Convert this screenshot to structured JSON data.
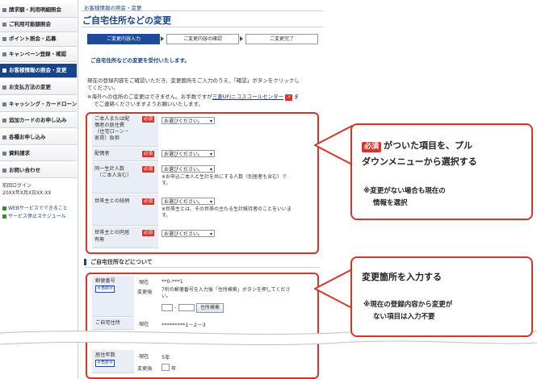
{
  "sidebar": {
    "items": [
      {
        "label": "請求額・利用明細照会",
        "active": false
      },
      {
        "label": "ご利用可能額照会",
        "active": false
      },
      {
        "label": "ポイント照会・応募",
        "active": false
      },
      {
        "label": "キャンペーン登録・確認",
        "active": false
      },
      {
        "label": "お客様情報の照会・変更",
        "active": true
      },
      {
        "label": "お支払方法の変更",
        "active": false
      },
      {
        "label": "キャッシング・カードローン",
        "active": false
      },
      {
        "label": "追加カードのお申し込み",
        "active": false
      },
      {
        "label": "各種お申し込み",
        "active": false
      },
      {
        "label": "資料請求",
        "active": false
      },
      {
        "label": "お問い合わせ",
        "active": false
      }
    ],
    "last_login_label": "前回ログイン",
    "last_login_value": "20XX年X月X日XX:XX",
    "links": [
      "WEBサービスでできること",
      "サービス停止スケジュール"
    ]
  },
  "header": {
    "breadcrumb": "お客様情報の照会・変更",
    "title": "ご自宅住所などの変更"
  },
  "steps": [
    "ご変更内容入力",
    "ご変更内容の確認",
    "ご変更完了"
  ],
  "intro": {
    "accept": "ご自宅住所などの変更を受付いたします。",
    "p1_l1": "現在の登録内容をご確認いただき、変更箇所をご入力のうえ、「確認」ボタンをクリックし",
    "p1_l2": "てください。",
    "p2_l1a": "※海外への住所のご変更はできません。お手数ですが",
    "p2_link": "三菱UFJニコスコールセンター",
    "p2_l1b": "ま",
    "p2_l2": "でご連絡くださいますようお願いいたします。"
  },
  "required_label": "必須",
  "select_placeholder": "お選びください。",
  "household": {
    "rows": [
      {
        "label_l1": "ご本人または配",
        "label_l2": "偶者の居住費",
        "label_l3": "（住宅ローン・",
        "label_l4": "家賃）負担",
        "note1": "",
        "note2": ""
      },
      {
        "label_l1": "配偶者",
        "label_l2": "",
        "label_l3": "",
        "label_l4": "",
        "note1": "",
        "note2": ""
      },
      {
        "label_l1": "同一生計人数",
        "label_l2": "（ご本人含む）",
        "label_l3": "",
        "label_l4": "",
        "note1": "※お申込ご本人と生計を共にする人数（別居者も含む）で",
        "note2": "す。"
      },
      {
        "label_l1": "世帯主との続柄",
        "label_l2": "",
        "label_l3": "",
        "label_l4": "",
        "note1": "※世帯主とは、その世帯の主たる生計維持者のことをいいま",
        "note2": "す。"
      },
      {
        "label_l1": "世帯主との同居",
        "label_l2": "有無",
        "label_l3": "",
        "label_l4": "",
        "note1": "",
        "note2": ""
      }
    ]
  },
  "address_section": {
    "heading": "ご自宅住所などについて",
    "postal_label": "郵便番号",
    "postal_badge": "半角数字",
    "current_label": "現在",
    "after_label": "変更後",
    "postal_current": "**0-***1",
    "postal_instruction_l1": "7桁の郵便番号を入力後「住所検索」ボタンを押してくださ",
    "postal_instruction_l2": "い。",
    "dash": "-",
    "search_button": "住所検索",
    "address_label": "ご自宅住所",
    "address_current": "*********1－2－3",
    "years_label": "居住年数",
    "years_current": "5年",
    "years_unit": "年"
  },
  "callouts": {
    "c1_req": "必須",
    "c1_title_a": "がついた項目を、プル",
    "c1_title_b": "ダウンメニューから選択する",
    "c1_note_a": "※変更がない場合も現在の",
    "c1_note_b": "情報を選択",
    "c2_title": "変更箇所を入力する",
    "c2_note_a": "※現在の登録内容から変更が",
    "c2_note_b": "ない項目は入力不要"
  },
  "colors": {
    "brand": "#16458c",
    "required": "#d9342b",
    "label_bg": "#e9eef6"
  }
}
